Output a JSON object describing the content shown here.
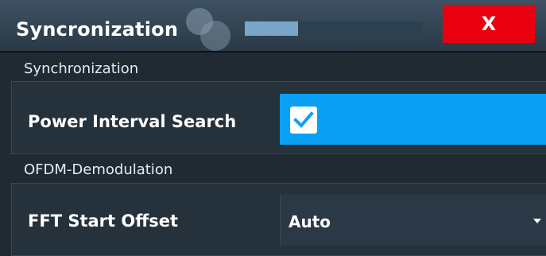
{
  "dialog": {
    "title": "Syncronization",
    "progress": 0.3,
    "close_label": "X"
  },
  "sections": {
    "sync": {
      "label": "Synchronization",
      "power_interval_search": {
        "label": "Power Interval Search",
        "checked": true
      }
    },
    "ofdm": {
      "label": "OFDM-Demodulation",
      "fft_start_offset": {
        "label": "FFT Start Offset",
        "value": "Auto"
      }
    }
  },
  "colors": {
    "accent": "#0aa0f5",
    "close": "#e8000f",
    "background": "#1f2a33"
  },
  "icons": [
    "close-icon",
    "checkmark-icon",
    "chevron-down-icon"
  ]
}
